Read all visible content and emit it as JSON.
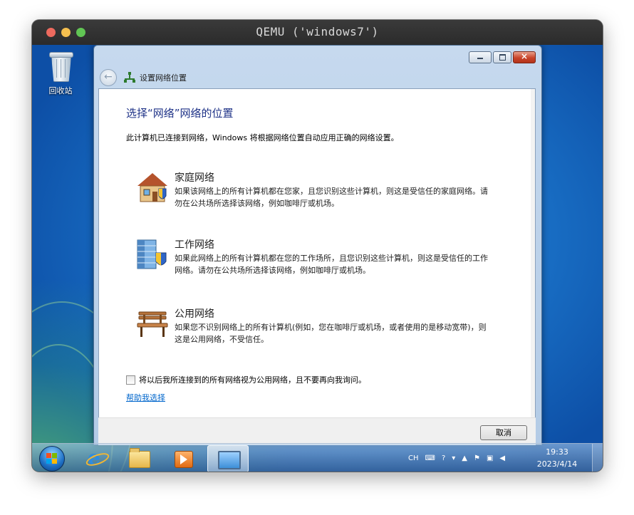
{
  "host_window": {
    "title": "QEMU ('windows7')"
  },
  "desktop": {
    "recycle_bin_label": "回收站"
  },
  "dialog": {
    "title": "设置网络位置",
    "heading": "选择“网络”网络的位置",
    "description": "此计算机已连接到网络，Windows 将根据网络位置自动应用正确的网络设置。",
    "options": [
      {
        "name": "家庭网络",
        "icon": "home-network-icon",
        "description": "如果该网络上的所有计算机都在您家，且您识别这些计算机，则这是受信任的家庭网络。请勿在公共场所选择该网络，例如咖啡厅或机场。"
      },
      {
        "name": "工作网络",
        "icon": "work-network-icon",
        "description": "如果此网络上的所有计算机都在您的工作场所，且您识别这些计算机，则这是受信任的工作网络。请勿在公共场所选择该网络，例如咖啡厅或机场。"
      },
      {
        "name": "公用网络",
        "icon": "public-network-icon",
        "description": "如果您不识别网络上的所有计算机(例如，您在咖啡厅或机场，或者使用的是移动宽带)，则这是公用网络，不受信任。"
      }
    ],
    "checkbox_label": "将以后我所连接到的所有网络视为公用网络，且不要再向我询问。",
    "checkbox_checked": false,
    "help_link": "帮助我选择",
    "cancel_button": "取消"
  },
  "taskbar": {
    "tray": {
      "language": "CH"
    },
    "clock": {
      "time": "19:33",
      "date": "2023/4/14"
    }
  },
  "colors": {
    "heading": "#1e3287",
    "link": "#0066cc",
    "close_button": "#c9442a"
  }
}
